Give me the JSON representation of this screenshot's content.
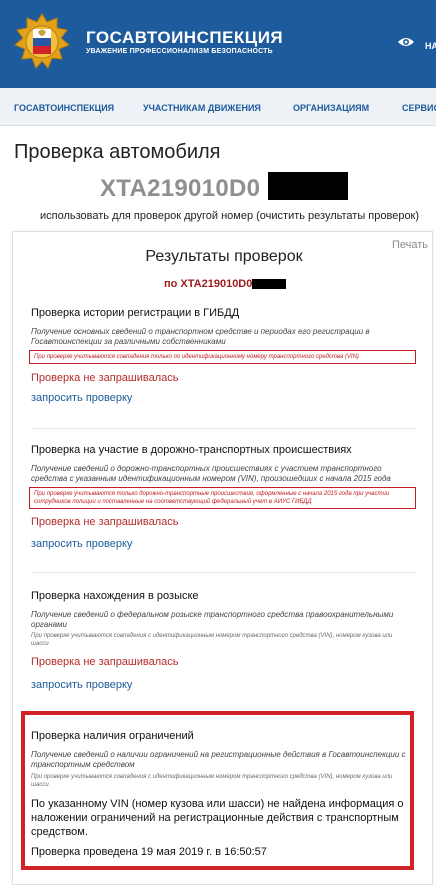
{
  "header": {
    "title": "ГОСАВТОИНСПЕКЦИЯ",
    "subtitle": "УВАЖЕНИЕ ПРОФЕССИОНАЛИЗМ БЕЗОПАСНОСТЬ",
    "right_link": "НА",
    "accent": "#1d5b9c"
  },
  "nav": {
    "items": [
      "ГОСАВТОИНСПЕКЦИЯ",
      "УЧАСТНИКАМ ДВИЖЕНИЯ",
      "ОРГАНИЗАЦИЯМ",
      "СЕРВИС"
    ]
  },
  "page": {
    "title": "Проверка автомобиля",
    "vin": "XTA219010D0",
    "reuse_hint": "использовать для проверок другой номер (очистить результаты проверок)"
  },
  "results": {
    "print_label": "Печать",
    "title": "Результаты проверок",
    "subtitle": "по XTA219010D0",
    "status_color": "#b52b2b",
    "alert_color": "#d2232a",
    "sections": [
      {
        "title": "Проверка истории регистрации в ГИБДД",
        "description": "Получение основных сведений о транспортном средстве и периодах его регистрации в Госавтоинспекции за различными собственниками",
        "note": "При проверке учитываются совпадения только по идентификационному номеру транспортного средства (VIN)",
        "status": "Проверка не запрашивалась",
        "action": "запросить проверку"
      },
      {
        "title": "Проверка на участие в дорожно-транспортных происшествиях",
        "description": "Получение сведений о дорожно-транспортных происшествиях с участием транспортного средства с указанным идентификационным номером (VIN), произошедших с начала 2015 года",
        "note": "При проверке учитываются только дорожно-транспортные происшествия, оформленные с начала 2015 года при участии сотрудников полиции и поставленные на соответствующий федеральный учет в АИУС ГИБДД",
        "status": "Проверка не запрашивалась",
        "action": "запросить проверку"
      },
      {
        "title": "Проверка нахождения в розыске",
        "description": "Получение сведений о федеральном розыске транспортного средства правоохранительными органами",
        "note": "При проверке учитываются совпадения с идентификационным номером транспортного средства (VIN), номером кузова или шасси",
        "status": "Проверка не запрашивалась",
        "action": "запросить проверку"
      },
      {
        "title": "Проверка наличия ограничений",
        "description": "Получение сведений о наличии ограничений на регистрационные действия в Госавтоинспекции с транспортным средством",
        "note": "При проверке учитываются совпадения с идентификационным номером транспортного средства (VIN), номером кузова или шасси",
        "result": "По указанному VIN (номер кузова или шасси) не найдена информация о наложении ограничений на регистрационные действия с транспортным средством.",
        "checked_at": "Проверка проведена 19 мая 2019 г. в 16:50:57"
      }
    ]
  }
}
